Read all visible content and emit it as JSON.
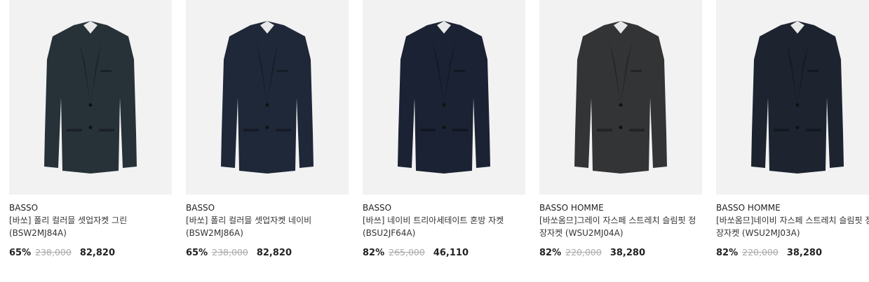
{
  "products": [
    {
      "brand": "BASSO",
      "name": "[바쏘] 폴리 컬러믈 셋업자켓 그린 (BSW2MJ84A)",
      "discount": "65%",
      "original_price": "238,000",
      "sale_price": "82,820",
      "jacket_color": "#273238"
    },
    {
      "brand": "BASSO",
      "name": "[바쏘] 폴리 컬러믈 셋업자켓 네이비 (BSW2MJ86A)",
      "discount": "65%",
      "original_price": "238,000",
      "sale_price": "82,820",
      "jacket_color": "#1f2838"
    },
    {
      "brand": "BASSO",
      "name": "[바쓰] 네이비 트리아세테이트 혼방 자켓 (BSU2JF64A)",
      "discount": "82%",
      "original_price": "265,000",
      "sale_price": "46,110",
      "jacket_color": "#1b2233"
    },
    {
      "brand": "BASSO HOMME",
      "name": "[바쏘옴므]그레이 자스페 스트레치 슬림핏 정장자켓 (WSU2MJ04A)",
      "discount": "82%",
      "original_price": "220,000",
      "sale_price": "38,280",
      "jacket_color": "#333436"
    },
    {
      "brand": "BASSO HOMME",
      "name": "[바쏘옴므]네이비 자스페 스트레치 슬림핏 정장자켓 (WSU2MJ03A)",
      "discount": "82%",
      "original_price": "220,000",
      "sale_price": "38,280",
      "jacket_color": "#1d2430"
    }
  ]
}
